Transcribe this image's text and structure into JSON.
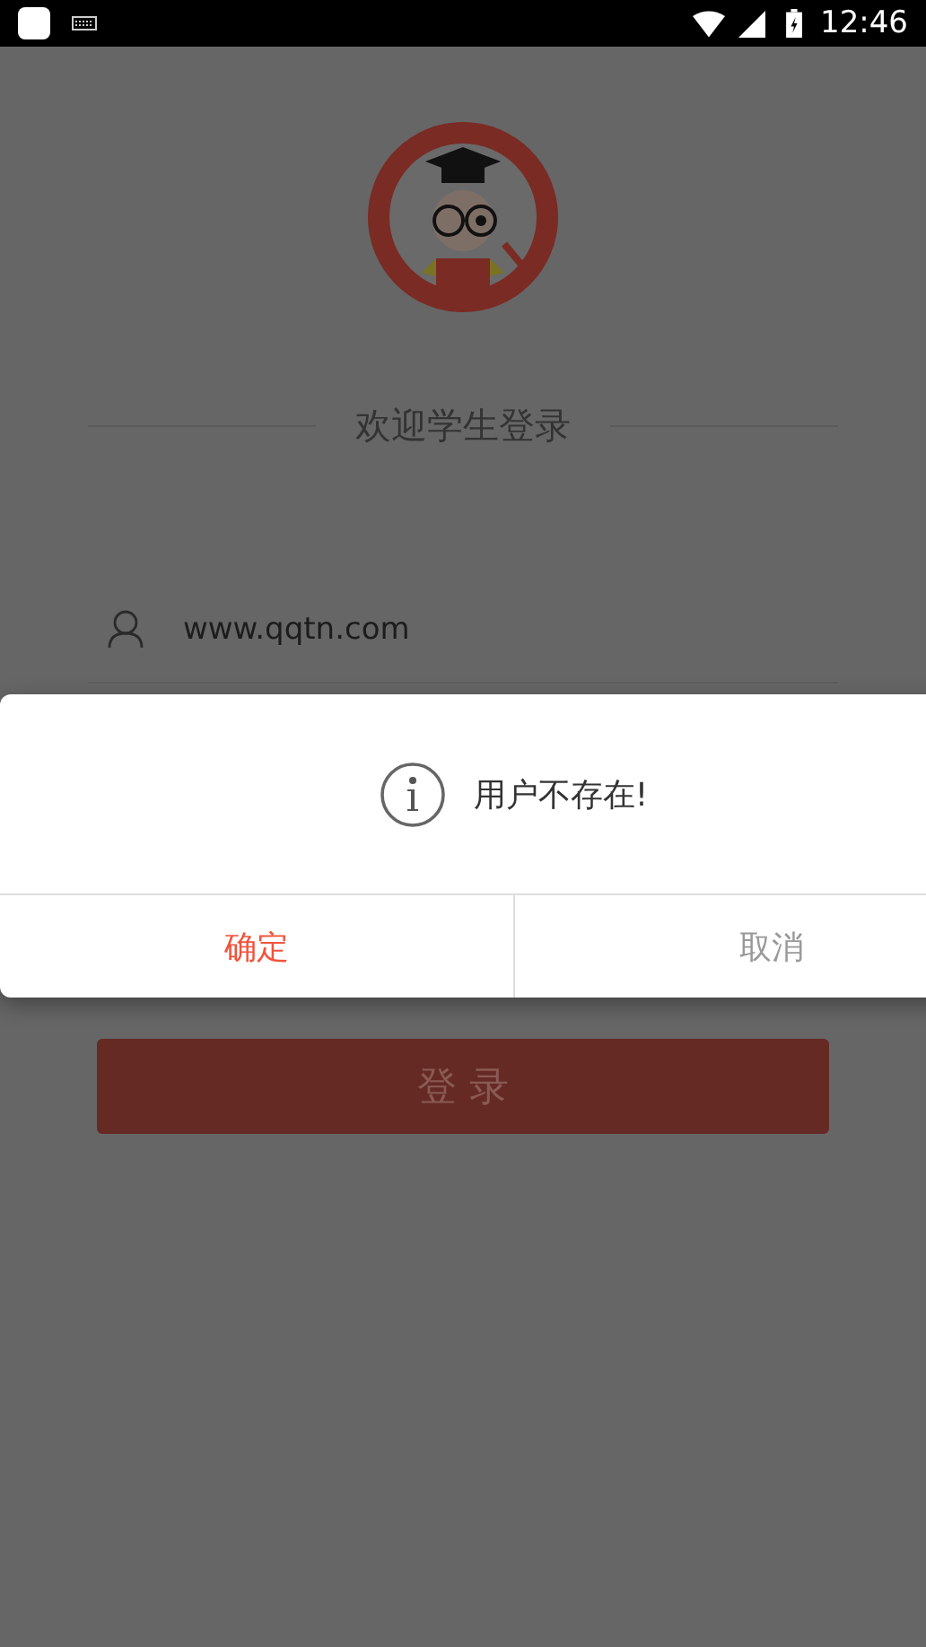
{
  "status_bar": {
    "time": "12:46"
  },
  "welcome_title": "欢迎学生登录",
  "username_field": {
    "value": "www.qqtn.com"
  },
  "login_button": {
    "label": "登 录"
  },
  "dialog": {
    "message": "用户不存在!",
    "buttons": [
      {
        "label": "确定",
        "kind": "primary"
      },
      {
        "label": "取消",
        "kind": "secondary"
      }
    ]
  }
}
